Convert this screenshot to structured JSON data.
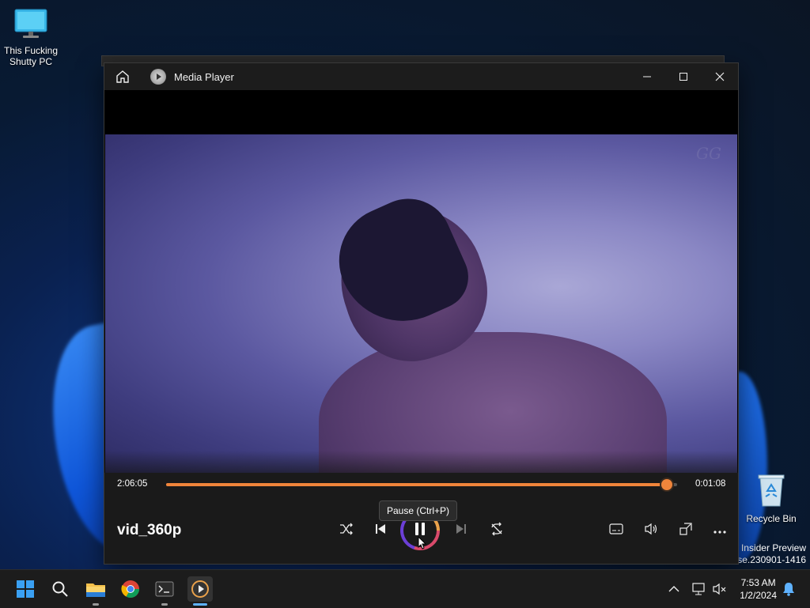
{
  "desktop": {
    "pc_icon_label": "This Fucking Shutty PC",
    "recycle_bin_label": "Recycle Bin",
    "insider_line1": "o Insider Preview",
    "insider_line2": "ease.230901-1416"
  },
  "player": {
    "app_title": "Media Player",
    "file_name": "vid_360p",
    "elapsed": "2:06:05",
    "remaining": "0:01:08",
    "progress_fraction": 0.98,
    "tooltip": "Pause (Ctrl+P)",
    "video_watermark": "GG",
    "accent": "#f0853b"
  },
  "taskbar": {
    "time": "7:53 AM",
    "date": "1/2/2024",
    "apps": [
      "start-icon",
      "search-icon",
      "file-explorer-icon",
      "chrome-icon",
      "terminal-icon",
      "media-player-icon"
    ]
  }
}
